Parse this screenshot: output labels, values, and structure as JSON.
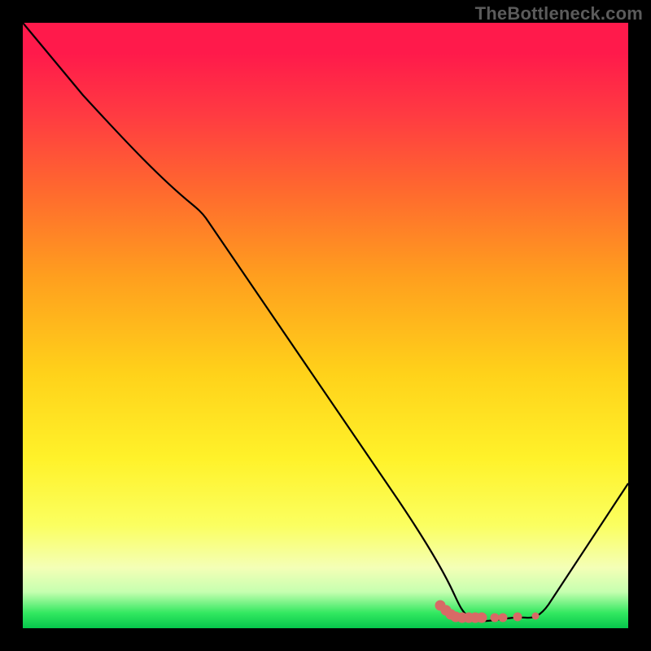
{
  "watermark": "TheBottleneck.com",
  "colors": {
    "background": "#000000",
    "watermark_text": "#5b5b5b",
    "curve_stroke": "#000000",
    "marker_fill": "#d86a66",
    "gradient_top": "#ff1a4b",
    "gradient_bottom": "#06c74c"
  },
  "chart_data": {
    "type": "line",
    "title": "",
    "xlabel": "",
    "ylabel": "",
    "xlim": [
      0,
      100
    ],
    "ylim": [
      0,
      100
    ],
    "grid": false,
    "series": [
      {
        "name": "bottleneck-curve",
        "x": [
          0,
          10,
          20,
          28,
          40,
          55,
          62,
          68,
          74,
          78,
          82,
          86,
          100
        ],
        "y": [
          100,
          88,
          77,
          70,
          52,
          30,
          18,
          8,
          2,
          1,
          1,
          2,
          24
        ]
      }
    ],
    "markers": {
      "name": "selected-range-markers",
      "x": [
        69,
        70,
        71,
        74,
        77,
        78.5,
        80,
        83
      ],
      "y": [
        2.2,
        1.8,
        1.6,
        1.4,
        1.4,
        1.4,
        1.4,
        1.4
      ]
    }
  }
}
